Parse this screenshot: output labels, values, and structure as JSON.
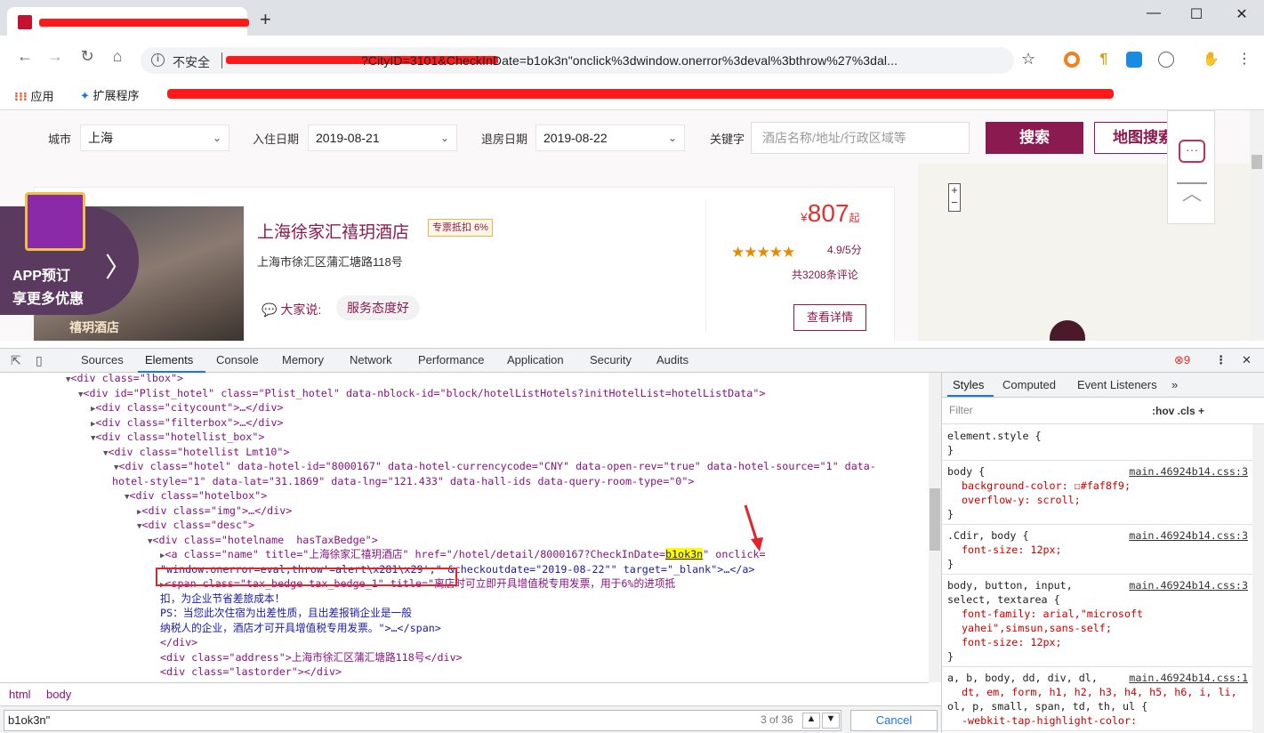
{
  "browser": {
    "tab_plus": "+",
    "window_controls": [
      "—",
      "☐",
      "✕"
    ],
    "insecure_label": "不安全",
    "url_visible": "?CityID=3101&CheckInDate=b1ok3n\"onclick%3dwindow.onerror%3deval%3bthrow%27%3dal...",
    "star_icon": "☆",
    "bookmarks": {
      "apps": "应用",
      "extensions": "扩展程序"
    }
  },
  "search": {
    "city_label": "城市",
    "city_value": "上海",
    "checkin_label": "入住日期",
    "checkin_value": "2019-08-21",
    "checkout_label": "退房日期",
    "checkout_value": "2019-08-22",
    "keyword_label": "关键字",
    "keyword_placeholder": "酒店名称/地址/行政区域等",
    "search_btn": "搜索",
    "map_btn": "地图搜索"
  },
  "promo": {
    "line1": "APP预订",
    "line2": "享更多优惠",
    "arrow": "〉"
  },
  "hotel": {
    "name": "上海徐家汇禧玥酒店",
    "tax_badge": "专票抵扣 6%",
    "address": "上海市徐汇区蒲汇塘路118号",
    "says_label": "大家说:",
    "says_chip": "服务态度好",
    "price_symbol": "¥",
    "price": "807",
    "price_suffix": "起",
    "stars": "★★★★★",
    "score": "4.9/5分",
    "reviews": "共3208条评论",
    "detail_btn": "查看详情",
    "image_caption": "禧玥酒店"
  },
  "devtools": {
    "tabs": [
      "Sources",
      "Elements",
      "Console",
      "Memory",
      "Network",
      "Performance",
      "Application",
      "Security",
      "Audits"
    ],
    "active_tab": "Elements",
    "error_count": "9",
    "side_tabs": [
      "Styles",
      "Computed",
      "Event Listeners",
      "»"
    ],
    "filter_placeholder": "Filter",
    "filter_tools": ":hov  .cls  +",
    "crumbs": [
      "html",
      "body"
    ],
    "find_value": "b1ok3n\"",
    "find_count": "3 of 36",
    "find_cancel": "Cancel"
  },
  "dom_lines": [
    "<div class=\"lbox\">",
    "<div id=\"Plist_hotel\" class=\"Plist_hotel\" data-nblock-id=\"block/hotelListHotels?initHotelList=hotelListData\">",
    "<div class=\"citycount\">…</div>",
    "<div class=\"filterbox\">…</div>",
    "<div class=\"hotellist_box\">",
    "<div class=\"hotellist Lmt10\">",
    "<div class=\"hotel\" data-hotel-id=\"8000167\" data-hotel-currencycode=\"CNY\" data-open-rev=\"true\" data-hotel-source=\"1\" data-",
    "hotel-style=\"1\" data-lat=\"31.1869\" data-lng=\"121.433\" data-hall-ids data-query-room-type=\"0\">",
    "<div class=\"hotelbox\">",
    "<div class=\"img\">…</div>",
    "<div class=\"desc\">",
    "<div class=\"hotelname  hasTaxBedge\">",
    "<a class=\"name\" title=\"上海徐家汇禧玥酒店\" href=\"/hotel/detail/8000167?CheckInDate=b1ok3n\" onclick=",
    "\"window.onerror=eval;throw'=alert\\x281\\x29';\" &checkoutdate=\"2019-08-22\"\" target=\"_blank\">…</a>",
    "<span class=\"tax_bedge tax_bedge_1\" title=\"离店时可立即开具增值税专用发票，用于6%的进项抵",
    "扣，为企业节省差旅成本！",
    "PS：当您此次住宿为出差性质，且出差报销企业是一般",
    "纳税人的企业，酒店才可开具增值税专用发票。\">…</span>",
    "</div>",
    "<div class=\"address\">上海市徐汇区蒲汇塘路118号</div>",
    "<div class=\"lastorder\"></div>"
  ],
  "styles": [
    {
      "selector": "element.style {",
      "src": "",
      "props": [
        "}"
      ]
    },
    {
      "selector": "body {",
      "src": "main.46924b14.css:3",
      "props": [
        "background-color: ☐#faf8f9;",
        "overflow-y: scroll;",
        "}"
      ]
    },
    {
      "selector": ".Cdir, body {",
      "src": "main.46924b14.css:3",
      "props": [
        "font-size: 12px;",
        "}"
      ]
    },
    {
      "selector": "body, button, input,",
      "src": "main.46924b14.css:3",
      "props": [
        "select, textarea {",
        "font-family: arial,\"microsoft",
        "yahei\",simsun,sans-self;",
        "font-size: 12px;",
        "}"
      ]
    },
    {
      "selector": "a, b, body, dd, div, dl,",
      "src": "main.46924b14.css:1",
      "props": [
        "dt, em, form, h1, h2, h3, h4, h5, h6, i, li,",
        "ol, p, small, span, td, th, ul {",
        "-webkit-tap-highlight-color:"
      ]
    }
  ],
  "colors": {
    "brand": "#8a1a4f",
    "redact": "#ff1a1a",
    "highlight": "#ffff00"
  }
}
